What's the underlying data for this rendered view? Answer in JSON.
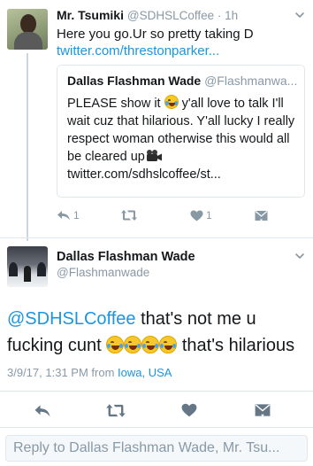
{
  "tweet_1": {
    "name": "Mr. Tsumiki",
    "handle_time": "@SDHSLCoffee · 1h",
    "text_line": "Here you go.Ur so pretty taking D",
    "link": "twitter.com/threstonparker...",
    "reply_count": "1",
    "like_count": "1",
    "icons": [
      "chevron-down-icon",
      "reply-icon",
      "retweet-icon",
      "heart-icon",
      "direct-message-icon"
    ]
  },
  "quoted_tweet": {
    "name": "Dallas Flashman Wade",
    "handle": "@Flashmanwa...",
    "text_part1": "PLEASE show it ",
    "text_part2": " y'all love to talk I'll wait cuz that hilarious. Y'all lucky I really respect woman otherwise this would all be cleared up",
    "link": "twitter.com/sdhslcoffee/st...",
    "icons": [
      "tears-of-joy-emoji",
      "movie-camera-emoji"
    ]
  },
  "tweet_2": {
    "name": "Dallas Flashman Wade",
    "handle": "@Flashmanwade",
    "mention": "@SDHSLCoffee",
    "text_part1": " that's not me u fucking cunt ",
    "text_part2": " that's hilarious",
    "emoji_count": 4,
    "timestamp": "3/9/17, 1:31 PM from ",
    "location": "Iowa, USA",
    "icons": [
      "chevron-down-icon",
      "reply-icon",
      "retweet-icon",
      "heart-icon",
      "direct-message-icon"
    ]
  },
  "reply_box": {
    "placeholder": "Reply to Dallas Flashman Wade, Mr. Tsu..."
  },
  "colors": {
    "link_blue": "#1b95e0",
    "secondary_gray": "#8899a6",
    "border": "#e1e8ed",
    "text": "#14171a"
  }
}
